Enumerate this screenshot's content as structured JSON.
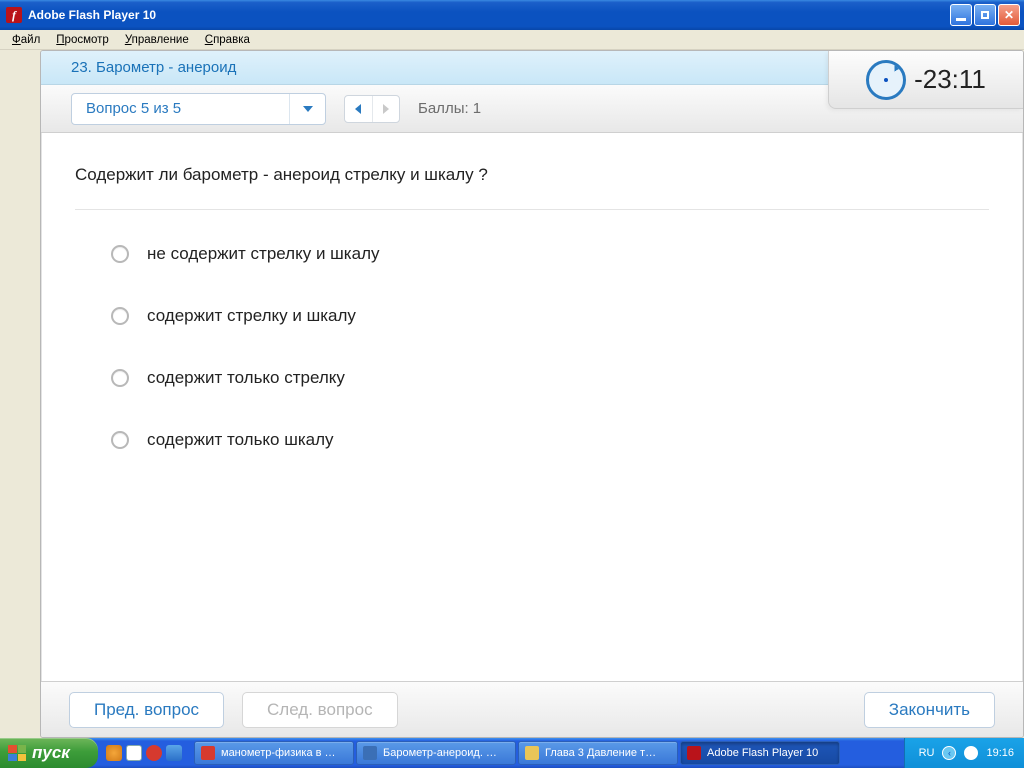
{
  "window": {
    "title": "Adobe Flash Player 10",
    "menu": [
      "Файл",
      "Просмотр",
      "Управление",
      "Справка"
    ]
  },
  "quiz": {
    "header_title": "23. Барометр - анероид",
    "question_selector": "Вопрос 5 из 5",
    "points_label": "Баллы: 1",
    "timer": "-23:11",
    "question_text": "Содержит ли барометр - анероид стрелку и шкалу ?",
    "answers": [
      "не содержит стрелку и шкалу",
      "содержит стрелку и шкалу",
      "содержит только стрелку",
      "содержит только шкалу"
    ],
    "buttons": {
      "prev": "Пред. вопрос",
      "next": "След. вопрос",
      "finish": "Закончить"
    }
  },
  "taskbar": {
    "start": "пуск",
    "tasks": [
      {
        "label": "манометр-физика в …",
        "icon_color": "#d63a2f"
      },
      {
        "label": "Барометр-анероид. …",
        "icon_color": "#3b6fb6"
      },
      {
        "label": "Глава 3 Давление т…",
        "icon_color": "#e9c558"
      },
      {
        "label": "Adobe Flash Player 10",
        "icon_color": "#b9131a",
        "active": true
      }
    ],
    "tray": {
      "lang": "RU",
      "time": "19:16"
    }
  }
}
